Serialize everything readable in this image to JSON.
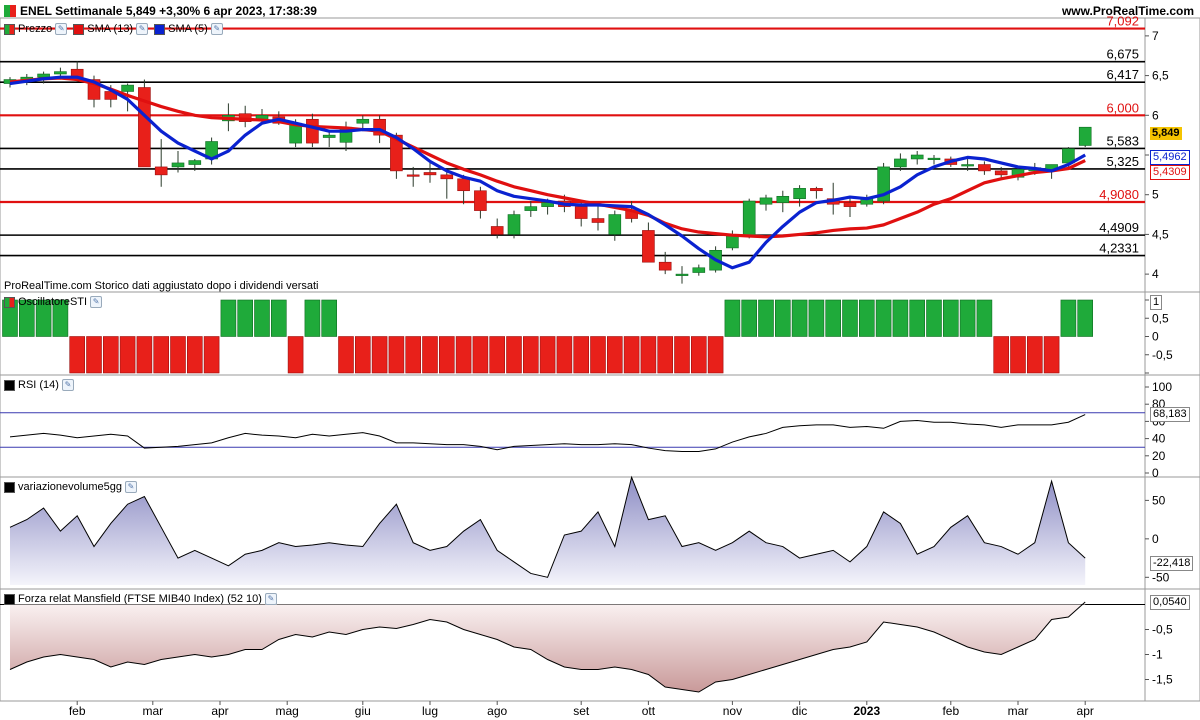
{
  "header": {
    "title": "ENEL Settimanale 5,849 +3,30% 6 apr 2023, 17:38:39",
    "site": "www.ProRealTime.com"
  },
  "note": "ProRealTime.com Storico dati aggiustato dopo i dividendi versati",
  "legends": {
    "price": "Prezzo",
    "sma13": "SMA (13)",
    "sma5": "SMA (5)",
    "sti": "OscillatoreSTI",
    "rsi": "RSI (14)",
    "vol": "variazionevolume5gg",
    "mansfield": "Forza relat Mansfield (FTSE MIB40 Index) (52 10)"
  },
  "colors": {
    "up": "#1faa3a",
    "down": "#e8201a",
    "sma13": "#e01010",
    "sma5": "#0a22d0",
    "price_tag": "#f5c400"
  },
  "chart_data": [
    {
      "type": "candlestick",
      "title": "ENEL Settimanale",
      "xlabels": [
        "feb",
        "mar",
        "apr",
        "mag",
        "giu",
        "lug",
        "ago",
        "set",
        "ott",
        "nov",
        "dic",
        "2023",
        "feb",
        "mar",
        "apr"
      ],
      "ylim": [
        3.8,
        7.2
      ],
      "yticks": [
        "4",
        "4,5",
        "5",
        "5,5",
        "6",
        "6,5",
        "7"
      ],
      "candles": [
        [
          6.4,
          6.48,
          6.35,
          6.45
        ],
        [
          6.45,
          6.52,
          6.38,
          6.48
        ],
        [
          6.48,
          6.55,
          6.4,
          6.52
        ],
        [
          6.52,
          6.6,
          6.45,
          6.55
        ],
        [
          6.58,
          6.68,
          6.42,
          6.45
        ],
        [
          6.45,
          6.5,
          6.1,
          6.2
        ],
        [
          6.3,
          6.38,
          6.1,
          6.2
        ],
        [
          6.3,
          6.4,
          6.05,
          6.38
        ],
        [
          6.35,
          6.45,
          5.8,
          5.35
        ],
        [
          5.35,
          5.7,
          5.1,
          5.25
        ],
        [
          5.35,
          5.55,
          5.28,
          5.4
        ],
        [
          5.38,
          5.45,
          5.3,
          5.43
        ],
        [
          5.45,
          5.72,
          5.38,
          5.67
        ],
        [
          5.93,
          6.15,
          5.8,
          6.0
        ],
        [
          6.02,
          6.12,
          5.85,
          5.92
        ],
        [
          5.95,
          6.08,
          5.9,
          6.0
        ],
        [
          5.98,
          6.05,
          5.88,
          5.9
        ],
        [
          5.65,
          5.95,
          5.6,
          5.9
        ],
        [
          5.95,
          6.02,
          5.6,
          5.65
        ],
        [
          5.72,
          5.8,
          5.6,
          5.75
        ],
        [
          5.66,
          5.92,
          5.55,
          5.85
        ],
        [
          5.9,
          6.0,
          5.8,
          5.95
        ],
        [
          5.95,
          6.0,
          5.65,
          5.75
        ],
        [
          5.75,
          5.78,
          5.2,
          5.3
        ],
        [
          5.25,
          5.35,
          5.1,
          5.24
        ],
        [
          5.28,
          5.4,
          5.15,
          5.25
        ],
        [
          5.25,
          5.32,
          4.95,
          5.2
        ],
        [
          5.2,
          5.25,
          4.88,
          5.05
        ],
        [
          5.05,
          5.1,
          4.7,
          4.8
        ],
        [
          4.6,
          4.7,
          4.45,
          4.5
        ],
        [
          4.5,
          4.8,
          4.45,
          4.75
        ],
        [
          4.8,
          4.92,
          4.72,
          4.85
        ],
        [
          4.85,
          4.95,
          4.75,
          4.9
        ],
        [
          4.92,
          5.0,
          4.78,
          4.85
        ],
        [
          4.85,
          4.9,
          4.6,
          4.7
        ],
        [
          4.7,
          4.88,
          4.55,
          4.65
        ],
        [
          4.5,
          4.8,
          4.42,
          4.75
        ],
        [
          4.8,
          4.92,
          4.65,
          4.7
        ],
        [
          4.55,
          4.65,
          4.2,
          4.15
        ],
        [
          4.15,
          4.28,
          4.0,
          4.05
        ],
        [
          4.0,
          4.1,
          3.88,
          4.0
        ],
        [
          4.02,
          4.12,
          3.98,
          4.08
        ],
        [
          4.05,
          4.35,
          4.02,
          4.3
        ],
        [
          4.33,
          4.55,
          4.3,
          4.48
        ],
        [
          4.48,
          4.95,
          4.45,
          4.92
        ],
        [
          4.88,
          5.0,
          4.8,
          4.96
        ],
        [
          4.9,
          5.05,
          4.78,
          4.98
        ],
        [
          4.95,
          5.12,
          4.85,
          5.08
        ],
        [
          5.08,
          5.1,
          4.95,
          5.05
        ],
        [
          4.95,
          5.15,
          4.75,
          4.88
        ],
        [
          4.9,
          4.98,
          4.72,
          4.85
        ],
        [
          4.88,
          5.0,
          4.85,
          4.95
        ],
        [
          4.92,
          5.4,
          4.88,
          5.35
        ],
        [
          5.35,
          5.52,
          5.3,
          5.45
        ],
        [
          5.45,
          5.55,
          5.38,
          5.5
        ],
        [
          5.45,
          5.5,
          5.38,
          5.46
        ],
        [
          5.45,
          5.48,
          5.35,
          5.38
        ],
        [
          5.38,
          5.45,
          5.3,
          5.38
        ],
        [
          5.38,
          5.42,
          5.25,
          5.3
        ],
        [
          5.3,
          5.35,
          5.2,
          5.25
        ],
        [
          5.22,
          5.35,
          5.18,
          5.32
        ],
        [
          5.3,
          5.4,
          5.25,
          5.34
        ],
        [
          5.3,
          5.38,
          5.2,
          5.38
        ],
        [
          5.4,
          5.6,
          5.35,
          5.58
        ],
        [
          5.62,
          5.85,
          5.6,
          5.85
        ]
      ],
      "series": [
        {
          "name": "SMA (13)",
          "values": [
            6.42,
            6.44,
            6.46,
            6.47,
            6.45,
            6.4,
            6.33,
            6.25,
            6.18,
            6.11,
            6.05,
            6.0,
            5.97,
            5.96,
            5.95,
            5.94,
            5.92,
            5.88,
            5.86,
            5.85,
            5.84,
            5.82,
            5.8,
            5.7,
            5.6,
            5.5,
            5.4,
            5.32,
            5.25,
            5.17,
            5.1,
            5.05,
            5.0,
            4.96,
            4.92,
            4.88,
            4.84,
            4.8,
            4.74,
            4.64,
            4.57,
            4.53,
            4.51,
            4.49,
            4.48,
            4.47,
            4.48,
            4.5,
            4.52,
            4.55,
            4.57,
            4.58,
            4.62,
            4.7,
            4.78,
            4.88,
            4.95,
            5.05,
            5.15,
            5.2,
            5.24,
            5.28,
            5.3,
            5.33,
            5.43
          ]
        },
        {
          "name": "SMA (5)",
          "values": [
            6.4,
            6.43,
            6.46,
            6.48,
            6.48,
            6.42,
            6.32,
            6.2,
            6.0,
            5.8,
            5.65,
            5.55,
            5.45,
            5.55,
            5.75,
            5.9,
            5.95,
            5.9,
            5.85,
            5.8,
            5.8,
            5.82,
            5.82,
            5.72,
            5.58,
            5.42,
            5.3,
            5.22,
            5.17,
            5.05,
            4.98,
            4.95,
            4.92,
            4.88,
            4.87,
            4.87,
            4.86,
            4.85,
            4.75,
            4.62,
            4.48,
            4.32,
            4.18,
            4.08,
            4.15,
            4.4,
            4.6,
            4.78,
            4.9,
            4.93,
            4.97,
            4.95,
            5.0,
            5.1,
            5.25,
            5.35,
            5.42,
            5.47,
            5.45,
            5.4,
            5.35,
            5.33,
            5.3,
            5.38,
            5.5
          ]
        }
      ],
      "levels": [
        {
          "value": 7.092,
          "label": "7,092",
          "color": "red"
        },
        {
          "value": 6.675,
          "label": "6,675",
          "color": "black"
        },
        {
          "value": 6.417,
          "label": "6,417",
          "color": "black"
        },
        {
          "value": 6.0,
          "label": "6,000",
          "color": "red"
        },
        {
          "value": 5.583,
          "label": "5,583",
          "color": "black"
        },
        {
          "value": 5.325,
          "label": "5,325",
          "color": "black"
        },
        {
          "value": 4.908,
          "label": "4,9080",
          "color": "red"
        },
        {
          "value": 4.4909,
          "label": "4,4909",
          "color": "black"
        },
        {
          "value": 4.2331,
          "label": "4,2331",
          "color": "black"
        }
      ],
      "last": {
        "price": "5,849",
        "sma5": "5,4962",
        "sma13": "5,4309"
      }
    },
    {
      "type": "bar",
      "title": "OscillatoreSTI",
      "ylim": [
        -1,
        1
      ],
      "yticks": [
        "1",
        "0,5",
        "0",
        "-0,5",
        "-1"
      ],
      "values": [
        1,
        1,
        1,
        1,
        -1,
        -1,
        -1,
        -1,
        -1,
        -1,
        -1,
        -1,
        -1,
        1,
        1,
        1,
        1,
        -1,
        1,
        1,
        -1,
        -1,
        -1,
        -1,
        -1,
        -1,
        -1,
        -1,
        -1,
        -1,
        -1,
        -1,
        -1,
        -1,
        -1,
        -1,
        -1,
        -1,
        -1,
        -1,
        -1,
        -1,
        -1,
        1,
        1,
        1,
        1,
        1,
        1,
        1,
        1,
        1,
        1,
        1,
        1,
        1,
        1,
        1,
        1,
        -1,
        -1,
        -1,
        -1,
        1,
        1
      ]
    },
    {
      "type": "line",
      "title": "RSI (14)",
      "ylim": [
        0,
        100
      ],
      "yticks": [
        "100",
        "80",
        "60",
        "40",
        "20",
        "0"
      ],
      "bands": [
        30,
        70
      ],
      "values": [
        42,
        44,
        46,
        44,
        41,
        43,
        45,
        43,
        29,
        30,
        31,
        33,
        35,
        41,
        46,
        44,
        43,
        41,
        45,
        43,
        45,
        47,
        43,
        35,
        35,
        34,
        33,
        33,
        31,
        27,
        31,
        32,
        33,
        34,
        33,
        33,
        34,
        33,
        29,
        26,
        25,
        25,
        28,
        36,
        42,
        46,
        53,
        55,
        56,
        56,
        53,
        54,
        52,
        60,
        61,
        59,
        59,
        57,
        56,
        53,
        56,
        56,
        56,
        59,
        68
      ]
    },
    {
      "type": "area",
      "title": "variazionevolume5gg",
      "ylim": [
        -60,
        70
      ],
      "yticks": [
        "50",
        "0",
        "-50"
      ],
      "values": [
        15,
        25,
        40,
        10,
        30,
        -10,
        20,
        45,
        55,
        15,
        -25,
        -15,
        -25,
        -35,
        -20,
        -15,
        -5,
        -10,
        -8,
        -5,
        -8,
        -10,
        20,
        45,
        -5,
        -15,
        -10,
        10,
        25,
        -15,
        -30,
        -45,
        -50,
        5,
        10,
        35,
        -10,
        80,
        25,
        30,
        -10,
        -5,
        -15,
        -5,
        10,
        -5,
        -10,
        -25,
        -20,
        -15,
        -30,
        -10,
        35,
        20,
        -20,
        -10,
        15,
        30,
        -5,
        -10,
        -20,
        -5,
        75,
        -5,
        -25
      ]
    },
    {
      "type": "area",
      "title": "Forza relat Mansfield (FTSE MIB40 Index) (52 10)",
      "ylim": [
        -1.85,
        0.15
      ],
      "yticks": [
        "-0,5",
        "-1",
        "-1,5"
      ],
      "values": [
        -1.3,
        -1.15,
        -1.05,
        -1.0,
        -1.05,
        -1.1,
        -1.25,
        -1.15,
        -1.2,
        -1.1,
        -1.05,
        -1.0,
        -1.05,
        -1.0,
        -0.9,
        -0.9,
        -0.7,
        -0.6,
        -0.65,
        -0.55,
        -0.6,
        -0.5,
        -0.45,
        -0.48,
        -0.4,
        -0.3,
        -0.35,
        -0.5,
        -0.6,
        -0.7,
        -0.85,
        -0.9,
        -1.1,
        -1.25,
        -1.3,
        -1.3,
        -1.25,
        -1.3,
        -1.4,
        -1.65,
        -1.7,
        -1.75,
        -1.55,
        -1.5,
        -1.4,
        -1.3,
        -1.2,
        -1.1,
        -1.0,
        -0.9,
        -0.85,
        -0.75,
        -0.35,
        -0.4,
        -0.45,
        -0.55,
        -0.7,
        -0.85,
        -0.95,
        -1.0,
        -0.85,
        -0.7,
        -0.3,
        -0.25,
        0.05
      ]
    }
  ],
  "indicator_values": {
    "sti": "1",
    "rsi": "68,183",
    "vol": "-22,418",
    "mansfield": "0,0540"
  }
}
